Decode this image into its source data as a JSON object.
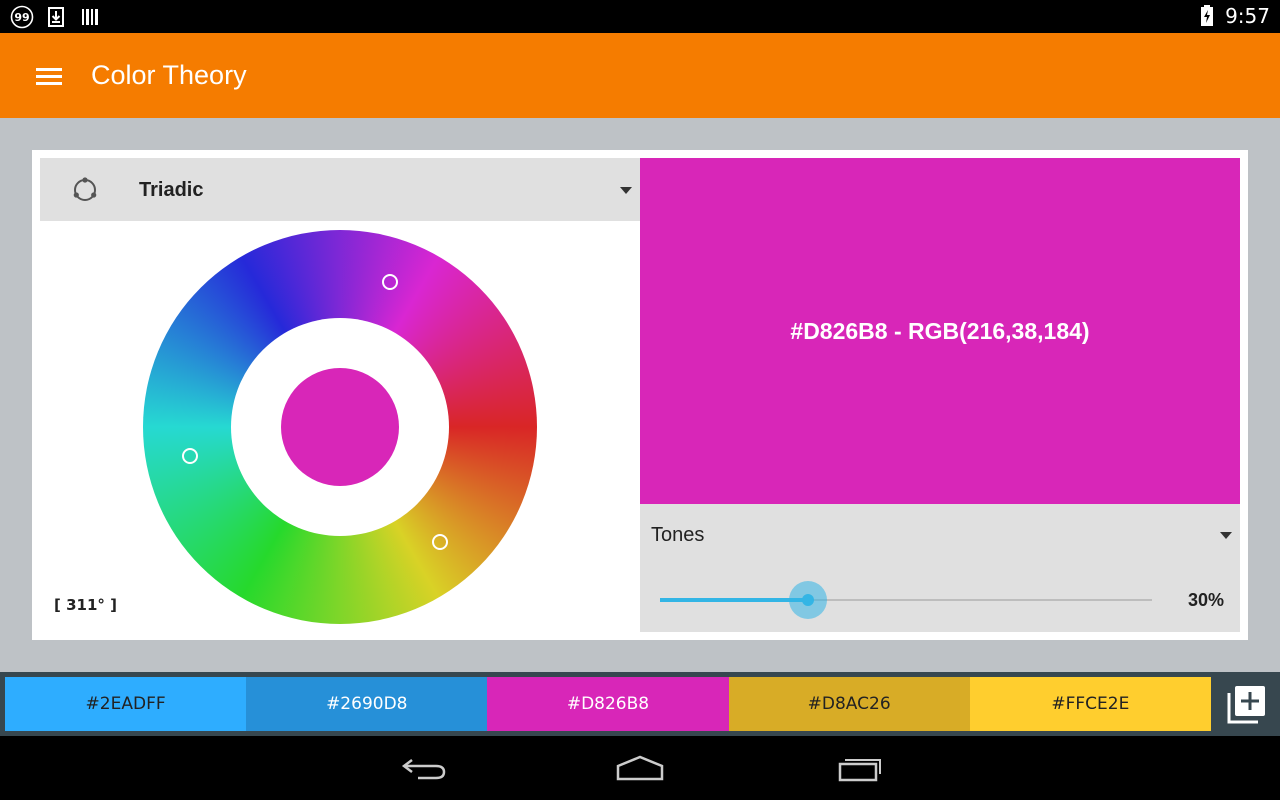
{
  "status_bar": {
    "notification_badge": "99",
    "time": "9:57",
    "icons": [
      "notification-count-icon",
      "download-icon",
      "barcode-icon",
      "battery-charging-icon"
    ]
  },
  "app_bar": {
    "title": "Color Theory",
    "menu_icon": "hamburger-menu-icon"
  },
  "scheme": {
    "selected": "Triadic",
    "icon": "triadic-scheme-icon"
  },
  "wheel": {
    "angle_label": "[ 311° ]",
    "center_color": "#D826B8",
    "handles": [
      {
        "name": "handle-primary",
        "hue": 311
      },
      {
        "name": "handle-secondary",
        "hue": 71
      },
      {
        "name": "handle-tertiary",
        "hue": 191
      }
    ]
  },
  "swatch": {
    "color": "#D826B8",
    "text": "#D826B8 - RGB(216,38,184)"
  },
  "tones": {
    "label": "Tones",
    "value": 0.3,
    "value_label": "30%",
    "accent": "#33B5E5"
  },
  "palette": [
    {
      "hex": "#2EADFF",
      "text_color": "#222222"
    },
    {
      "hex": "#2690D8",
      "text_color": "#FFFFFF"
    },
    {
      "hex": "#D826B8",
      "text_color": "#FFFFFF"
    },
    {
      "hex": "#D8AC26",
      "text_color": "#222222"
    },
    {
      "hex": "#FFCE2E",
      "text_color": "#222222"
    }
  ],
  "add_button_icon": "add-to-collection-icon",
  "nav": {
    "back_icon": "back-icon",
    "home_icon": "home-icon",
    "recents_icon": "recent-apps-icon"
  },
  "colors": {
    "app_bar": "#F57C00",
    "content_bg": "#BEC2C6",
    "panel_bg": "#E0E0E0",
    "palette_bar": "#37474F"
  }
}
